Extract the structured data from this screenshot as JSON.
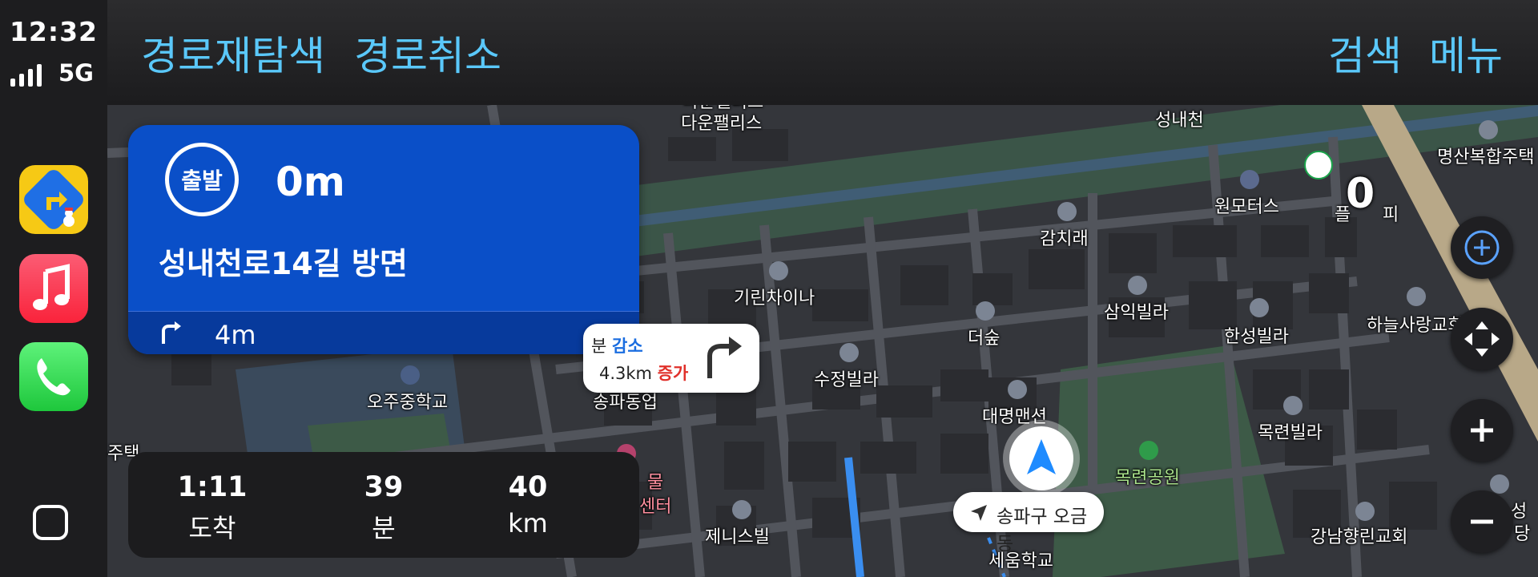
{
  "status": {
    "time": "12:32",
    "network": "5G"
  },
  "dock": {
    "apps": [
      {
        "name": "TMAP",
        "icon": "tmap-app-icon"
      },
      {
        "name": "Music",
        "icon": "music-app-icon"
      },
      {
        "name": "Phone",
        "icon": "phone-app-icon"
      }
    ],
    "home_icon": "home-grid-icon"
  },
  "topbar": {
    "reroute": "경로재탐색",
    "cancel_route": "경로취소",
    "search": "검색",
    "menu": "메뉴"
  },
  "guidance": {
    "badge": "출발",
    "distance": "0m",
    "road": "성내천로14길 방면",
    "next_turn_icon": "turn-right-icon",
    "next_distance": "4m"
  },
  "route_callout": {
    "time_prefix": "분",
    "time_change": "감소",
    "distance_value": "4.3km",
    "distance_change": "증가",
    "turn_icon": "turn-right-icon"
  },
  "eta": {
    "arrival_time": "1:11",
    "arrival_label": "도착",
    "minutes": "39",
    "minutes_label": "분",
    "distance": "40",
    "distance_label": "km"
  },
  "current_location": {
    "label": "송파구 오금동"
  },
  "map_labels": {
    "l1": "다운팰리스",
    "l2": "성내천",
    "l3": "명산복합주택",
    "l4": "원모터스",
    "l5": "플",
    "l6": "피",
    "l7": "감치래",
    "l8": "기린차이나",
    "l9": "삼익빌라",
    "l10": "한성빌라",
    "l11": "하늘사랑교회",
    "l12": "더숲",
    "l13": "수정빌라",
    "l14": "오주중학교",
    "l15": "송파동업",
    "l16": "대명맨션",
    "l17": "목련빌라",
    "l18": "목련공원",
    "l19": "주택",
    "l20": "물",
    "l21": "센터",
    "l22": "제니스빌",
    "l23": "세움학교",
    "l24": "강남향린교회",
    "l25": "성",
    "l26": "당"
  },
  "map_digit": "0",
  "map_controls": {
    "compass": "compass-icon",
    "pan": "pan-arrows-icon",
    "zoom_in": "zoom-in-icon",
    "zoom_out": "zoom-out-icon"
  },
  "colors": {
    "accent": "#5ac8fa",
    "guidance_bg": "#0a4fc8",
    "park_green": "#3d5a47",
    "map_bg": "#34363b"
  }
}
